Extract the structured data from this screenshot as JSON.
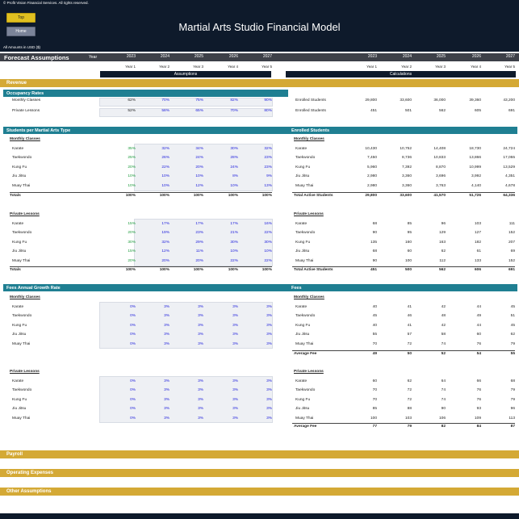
{
  "header": {
    "copyright": "© Profit Vision Financial Services. All rights reserved.",
    "top_button": "Top",
    "home_button": "Home",
    "title": "Martial Arts Studio Financial Model",
    "amounts": "All Amounts in  USD ($)"
  },
  "forecast": {
    "title": "Forecast Assumptions",
    "year_label": "Year",
    "years": [
      "2023",
      "2024",
      "2025",
      "2026",
      "2027"
    ],
    "year_subs": [
      "Year 1",
      "Year 2",
      "Year 3",
      "Year 4",
      "Year 5"
    ],
    "assumptions_label": "Assumptions",
    "calculations_label": "Calculations"
  },
  "sections": {
    "revenue": "Revenue",
    "payroll": "Payroll",
    "operating": "Operating Expenses",
    "other": "Other Assumptions"
  },
  "occupancy": {
    "title": "Occupancy Rates",
    "rows": [
      {
        "label": "Monthly Classes",
        "vals": [
          "62%",
          "70%",
          "75%",
          "82%",
          "90%"
        ],
        "calc_label": "Enrolled Students",
        "calc": [
          "29,800",
          "33,600",
          "36,000",
          "39,360",
          "43,200"
        ]
      },
      {
        "label": "Private Lessons",
        "vals": [
          "52%",
          "58%",
          "65%",
          "70%",
          "80%"
        ],
        "calc_label": "Enrolled Students",
        "calc": [
          "451",
          "501",
          "562",
          "605",
          "691"
        ]
      }
    ]
  },
  "students_type": {
    "title": "Students per Martial Arts Type",
    "calc_title": "Enrolled Students",
    "monthly_label": "Monthly Classes",
    "private_label": "Private Lessons",
    "monthly": [
      {
        "label": "Karate",
        "vals": [
          "35%",
          "32%",
          "34%",
          "30%",
          "32%"
        ],
        "calc": [
          "10,430",
          "10,752",
          "14,408",
          "18,730",
          "24,724"
        ]
      },
      {
        "label": "Taekwondo",
        "vals": [
          "25%",
          "26%",
          "24%",
          "28%",
          "23%"
        ],
        "calc": [
          "7,450",
          "8,736",
          "10,833",
          "13,866",
          "17,055"
        ]
      },
      {
        "label": "Kung Fu",
        "vals": [
          "20%",
          "22%",
          "20%",
          "24%",
          "23%"
        ],
        "calc": [
          "5,960",
          "7,392",
          "8,870",
          "10,999",
          "13,529"
        ]
      },
      {
        "label": "Jiu Jitsu",
        "vals": [
          "10%",
          "10%",
          "10%",
          "8%",
          "9%"
        ],
        "calc": [
          "2,980",
          "3,360",
          "3,696",
          "3,992",
          "4,351"
        ]
      },
      {
        "label": "Muay Thai",
        "vals": [
          "10%",
          "10%",
          "12%",
          "10%",
          "13%"
        ],
        "calc": [
          "2,980",
          "3,360",
          "3,763",
          "4,140",
          "4,678"
        ]
      }
    ],
    "monthly_total_label": "Totals",
    "monthly_totals": [
      "100%",
      "100%",
      "100%",
      "100%",
      "100%"
    ],
    "monthly_calc_total_label": "Total Active Students",
    "monthly_calc_totals": [
      "29,800",
      "33,600",
      "41,570",
      "51,726",
      "64,336"
    ],
    "private": [
      {
        "label": "Karate",
        "vals": [
          "15%",
          "17%",
          "17%",
          "17%",
          "16%"
        ],
        "calc": [
          "68",
          "85",
          "96",
          "103",
          "111"
        ]
      },
      {
        "label": "Taekwondo",
        "vals": [
          "20%",
          "19%",
          "23%",
          "21%",
          "22%"
        ],
        "calc": [
          "90",
          "95",
          "129",
          "127",
          "152"
        ]
      },
      {
        "label": "Kung Fu",
        "vals": [
          "30%",
          "32%",
          "29%",
          "30%",
          "30%"
        ],
        "calc": [
          "135",
          "160",
          "163",
          "182",
          "207"
        ]
      },
      {
        "label": "Jiu Jitsu",
        "vals": [
          "15%",
          "12%",
          "11%",
          "10%",
          "10%"
        ],
        "calc": [
          "68",
          "60",
          "62",
          "61",
          "69"
        ]
      },
      {
        "label": "Muay Thai",
        "vals": [
          "20%",
          "20%",
          "20%",
          "22%",
          "22%"
        ],
        "calc": [
          "90",
          "100",
          "112",
          "133",
          "152"
        ]
      }
    ],
    "private_total_label": "Totals",
    "private_totals": [
      "100%",
      "100%",
      "100%",
      "100%",
      "100%"
    ],
    "private_calc_total_label": "Total Active Students",
    "private_calc_totals": [
      "451",
      "500",
      "562",
      "606",
      "691"
    ]
  },
  "fees": {
    "title": "Fees Annual Growth Rate",
    "calc_title": "Fees",
    "monthly_label": "Monthly Classes",
    "private_label": "Private Lessons",
    "monthly": [
      {
        "label": "Karate",
        "vals": [
          "0%",
          "3%",
          "3%",
          "3%",
          "3%"
        ],
        "calc": [
          "40",
          "41",
          "42",
          "44",
          "45"
        ]
      },
      {
        "label": "Taekwondo",
        "vals": [
          "0%",
          "3%",
          "3%",
          "3%",
          "3%"
        ],
        "calc": [
          "45",
          "46",
          "48",
          "49",
          "51"
        ]
      },
      {
        "label": "Kung Fu",
        "vals": [
          "0%",
          "3%",
          "3%",
          "3%",
          "3%"
        ],
        "calc": [
          "40",
          "41",
          "42",
          "44",
          "45"
        ]
      },
      {
        "label": "Jiu Jitsu",
        "vals": [
          "0%",
          "3%",
          "3%",
          "3%",
          "3%"
        ],
        "calc": [
          "55",
          "57",
          "58",
          "60",
          "62"
        ]
      },
      {
        "label": "Muay Thai",
        "vals": [
          "0%",
          "3%",
          "3%",
          "3%",
          "3%"
        ],
        "calc": [
          "70",
          "72",
          "74",
          "76",
          "79"
        ]
      }
    ],
    "monthly_avg_label": "Average Fee",
    "monthly_avg": [
      "49",
      "50",
      "52",
      "54",
      "55"
    ],
    "private": [
      {
        "label": "Karate",
        "vals": [
          "0%",
          "3%",
          "3%",
          "3%",
          "3%"
        ],
        "calc": [
          "60",
          "62",
          "64",
          "66",
          "68"
        ]
      },
      {
        "label": "Taekwondo",
        "vals": [
          "0%",
          "3%",
          "3%",
          "3%",
          "3%"
        ],
        "calc": [
          "70",
          "72",
          "74",
          "76",
          "79"
        ]
      },
      {
        "label": "Kung Fu",
        "vals": [
          "0%",
          "3%",
          "3%",
          "3%",
          "3%"
        ],
        "calc": [
          "70",
          "72",
          "74",
          "76",
          "79"
        ]
      },
      {
        "label": "Jiu Jitsu",
        "vals": [
          "0%",
          "3%",
          "3%",
          "3%",
          "3%"
        ],
        "calc": [
          "85",
          "88",
          "90",
          "93",
          "96"
        ]
      },
      {
        "label": "Muay Thai",
        "vals": [
          "0%",
          "3%",
          "3%",
          "3%",
          "3%"
        ],
        "calc": [
          "100",
          "103",
          "106",
          "109",
          "113"
        ]
      }
    ],
    "private_avg_label": "Average Fee",
    "private_avg": [
      "77",
      "79",
      "82",
      "84",
      "87"
    ]
  },
  "colors": {
    "navy": "#0e1a2b",
    "gold": "#d4a935",
    "teal": "#1f7f92",
    "input_blue": "#2222dd",
    "input_green": "#1a9a3a"
  }
}
